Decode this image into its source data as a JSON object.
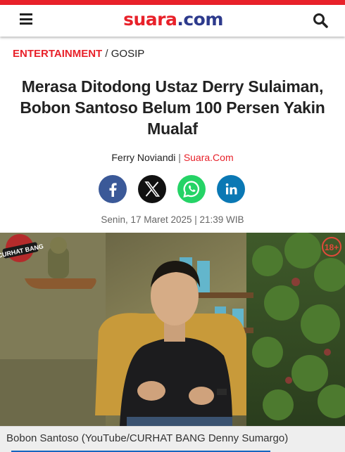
{
  "header": {
    "logo_part1": "suara",
    "logo_part2": ".com",
    "brand_red": "#e8212a",
    "brand_blue": "#2d3a8c"
  },
  "breadcrumb": {
    "category": "ENTERTAINMENT",
    "separator": " / ",
    "subcategory": "GOSIP"
  },
  "article": {
    "title": "Merasa Ditodong Ustaz Derry Sulaiman, Bobon Santoso Belum 100 Persen Yakin Mualaf",
    "author": "Ferry Noviandi",
    "byline_separator": " | ",
    "source": "Suara.Com",
    "date": "Senin, 17 Maret 2025 | 21:39 WIB"
  },
  "share": [
    {
      "name": "facebook",
      "icon": "facebook-icon",
      "color": "#3b5998"
    },
    {
      "name": "x",
      "icon": "x-icon",
      "color": "#111111"
    },
    {
      "name": "whatsapp",
      "icon": "whatsapp-icon",
      "color": "#25d366"
    },
    {
      "name": "linkedin",
      "icon": "linkedin-icon",
      "color": "#0a78b4"
    }
  ],
  "photo": {
    "overlay_badge": "CURHAT BANG",
    "rating_badge": "18+",
    "caption": "Bobon Santoso (YouTube/CURHAT BANG Denny Sumargo)"
  }
}
